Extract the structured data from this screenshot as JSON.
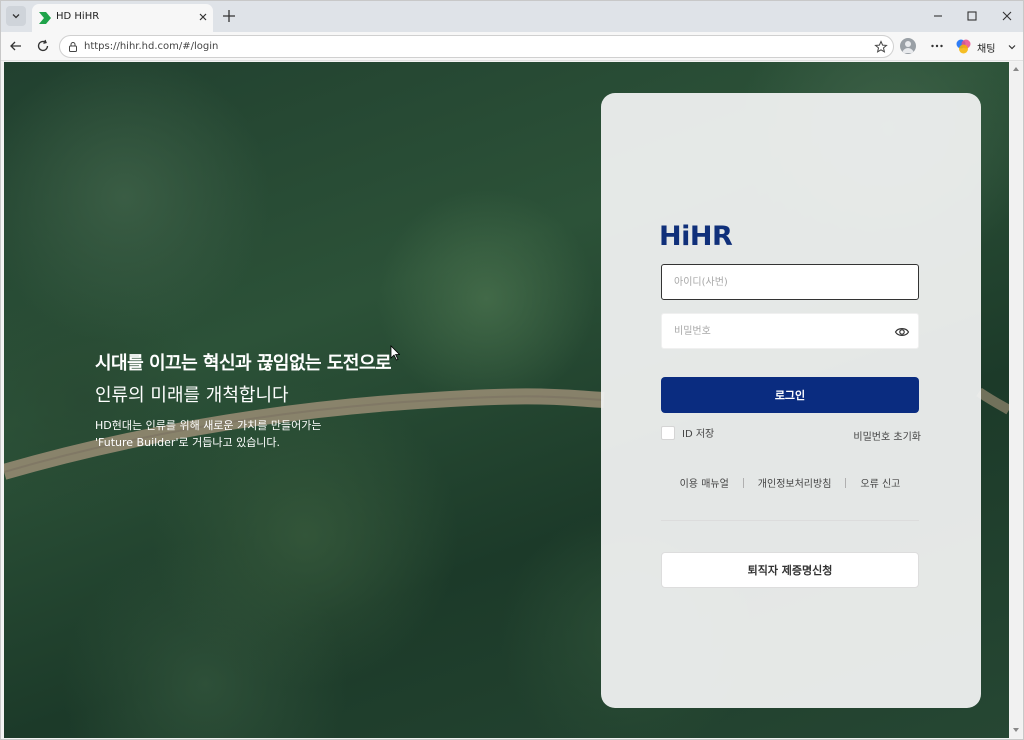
{
  "browser": {
    "tab_title": "HD HiHR",
    "url": "https://hihr.hd.com/#/login",
    "copilot_label": "채팅",
    "icons": [
      "tab-list-icon",
      "favicon-icon",
      "close-icon",
      "plus-icon",
      "minimize-icon",
      "maximize-icon",
      "window-close-icon",
      "back-icon",
      "reload-icon",
      "lock-icon",
      "star-icon",
      "profile-icon",
      "more-icon",
      "copilot-icon",
      "chevron-down-icon"
    ]
  },
  "hero": {
    "line1": "시대를 이끄는 혁신과 끊임없는 도전으로",
    "line2": "인류의 미래를 개척합니다",
    "desc1": "HD현대는 인류를 위해 새로운 가치를 만들어가는",
    "desc2": "'Future Builder'로 거듭나고 있습니다."
  },
  "login": {
    "logo": "HiHR",
    "id_placeholder": "아이디(사번)",
    "pw_placeholder": "비밀번호",
    "login_button": "로그인",
    "save_id_label": "ID 저장",
    "reset_pw": "비밀번호 초기화",
    "links": [
      "이용 매뉴얼",
      "개인정보처리방침",
      "오류 신고"
    ],
    "cert_button": "퇴직자 제증명신청"
  },
  "colors": {
    "brand": "#10307a",
    "login_button": "#0a2c80"
  }
}
